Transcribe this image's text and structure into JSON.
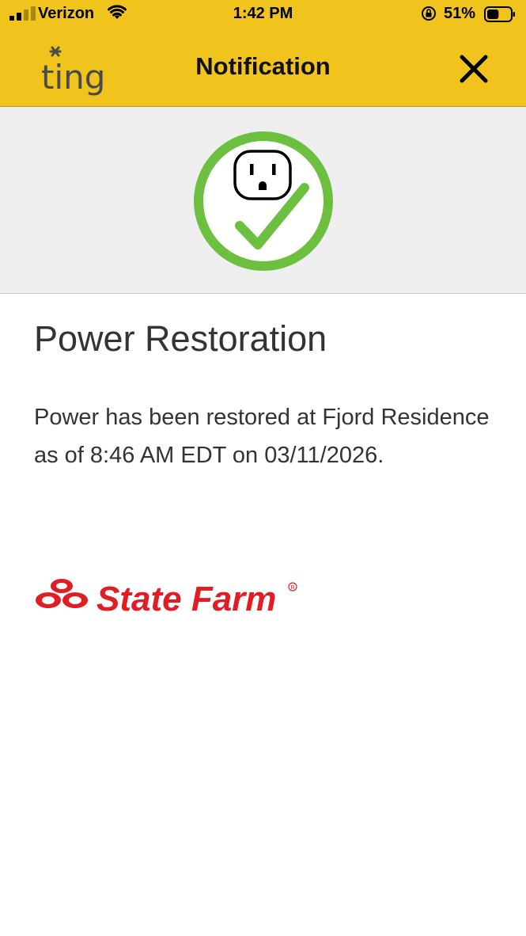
{
  "status_bar": {
    "carrier": "Verizon",
    "time": "1:42 PM",
    "battery_percent": "51%",
    "signal_bars_filled": 2,
    "signal_bars_total": 4,
    "battery_level": 0.51
  },
  "header": {
    "logo_text": "ting",
    "title": "Notification",
    "background_color": "#f1c31d"
  },
  "hero": {
    "icon": "outlet-checkmark-icon",
    "ring_color": "#6cbf3f"
  },
  "notification": {
    "heading": "Power Restoration",
    "message": "Power has been restored at Fjord Residence as of 8:46 AM EDT on 03/11/2026."
  },
  "sponsor": {
    "brand": "State Farm",
    "brand_color": "#e31b23"
  }
}
